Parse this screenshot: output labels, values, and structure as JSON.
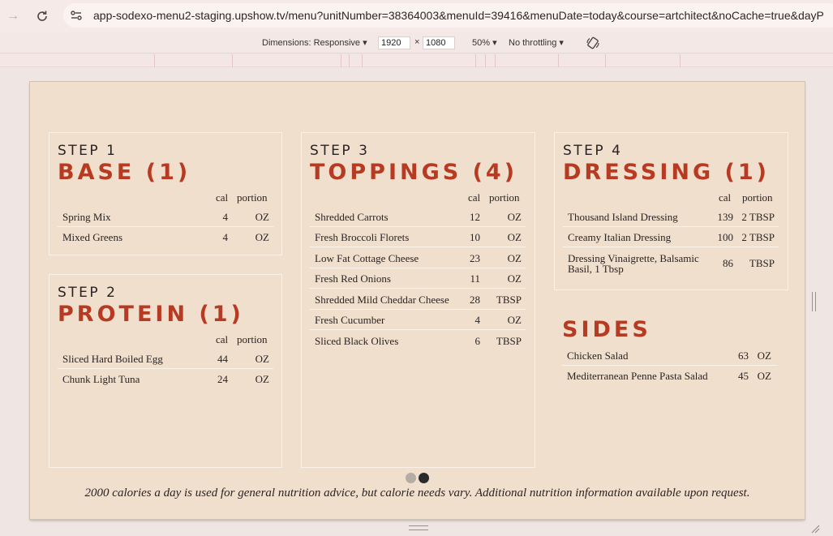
{
  "browser": {
    "url": "app-sodexo-menu2-staging.upshow.tv/menu?unitNumber=38364003&menuId=39416&menuDate=today&course=artchitect&noCache=true&dayP"
  },
  "devtools": {
    "dimensions_label": "Dimensions: Responsive",
    "width": "1920",
    "times": "×",
    "height": "1080",
    "zoom": "50%",
    "throttling": "No throttling"
  },
  "menu": {
    "cal_header": "cal",
    "portion_header": "portion",
    "step1": {
      "label": "STEP 1",
      "title": "BASE (1)",
      "items": [
        {
          "name": "Spring Mix",
          "cal": "4",
          "portion": "OZ"
        },
        {
          "name": "Mixed Greens",
          "cal": "4",
          "portion": "OZ"
        }
      ]
    },
    "step2": {
      "label": "STEP 2",
      "title": "PROTEIN (1)",
      "items": [
        {
          "name": "Sliced Hard Boiled Egg",
          "cal": "44",
          "portion": "OZ"
        },
        {
          "name": "Chunk Light Tuna",
          "cal": "24",
          "portion": "OZ"
        }
      ]
    },
    "step3": {
      "label": "STEP 3",
      "title": "TOPPINGS (4)",
      "items": [
        {
          "name": "Shredded Carrots",
          "cal": "12",
          "portion": "OZ"
        },
        {
          "name": "Fresh Broccoli Florets",
          "cal": "10",
          "portion": "OZ"
        },
        {
          "name": "Low Fat Cottage Cheese",
          "cal": "23",
          "portion": "OZ"
        },
        {
          "name": "Fresh Red Onions",
          "cal": "11",
          "portion": "OZ"
        },
        {
          "name": "Shredded Mild Cheddar Cheese",
          "cal": "28",
          "portion": "TBSP"
        },
        {
          "name": "Fresh Cucumber",
          "cal": "4",
          "portion": "OZ"
        },
        {
          "name": "Sliced Black Olives",
          "cal": "6",
          "portion": "TBSP"
        }
      ]
    },
    "step4": {
      "label": "STEP 4",
      "title": "DRESSING (1)",
      "items": [
        {
          "name": "Thousand Island Dressing",
          "cal": "139",
          "portion": "2 TBSP"
        },
        {
          "name": "Creamy Italian Dressing",
          "cal": "100",
          "portion": "2 TBSP"
        },
        {
          "name": "Dressing Vinaigrette, Balsamic Basil, 1 Tbsp",
          "cal": "86",
          "portion": "TBSP"
        }
      ]
    },
    "sides": {
      "title": "SIDES",
      "items": [
        {
          "name": "Chicken Salad",
          "cal": "63",
          "portion": "OZ"
        },
        {
          "name": "Mediterranean Penne Pasta Salad",
          "cal": "45",
          "portion": "OZ"
        }
      ]
    },
    "footnote": "2000 calories a day is used for general nutrition advice, but calorie needs vary. Additional nutrition information available upon request."
  },
  "colors": {
    "accent": "#b73b22",
    "background": "#f0dfcd",
    "dot_inactive": "#b5aca6",
    "dot_active": "#2a2a2a"
  },
  "icons": {
    "back": "arrow-left-icon",
    "reload": "reload-icon",
    "site": "site-settings-icon",
    "rotate": "rotate-icon"
  }
}
